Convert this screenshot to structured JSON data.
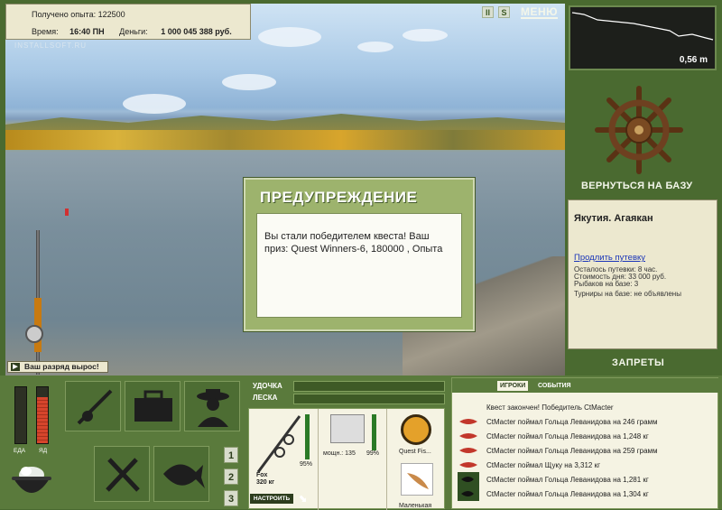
{
  "hud": {
    "exp_label": "Получено опыта:",
    "exp_value": "122500",
    "time_label": "Время:",
    "time_value": "16:40 ПН",
    "money_label": "Деньги:",
    "money_value": "1 000 045 388 руб."
  },
  "watermark": "INSTALLSOFT.RU",
  "controls": {
    "pause": "II",
    "sound": "S",
    "menu": "МЕНЮ"
  },
  "depth_readout": "0,56 m",
  "return_label": "ВЕРНУТЬСЯ НА БАЗУ",
  "location": {
    "title": "Якутия. Агаякан",
    "extend_link": "Продлить путевку",
    "lines": [
      "Осталось путевки: 8 час.",
      "Стоимость дня: 33 000 руб.",
      "Рыбаков на базе: 3",
      "Турниры на базе: не объявлены"
    ]
  },
  "bans_label": "ЗАПРЕТЫ",
  "dialog": {
    "title": "ПРЕДУПРЕЖДЕНИЕ",
    "message": "Вы стали победителем квеста! Ваш приз: Quest Winners-6, 180000 , Опыта"
  },
  "rank_message": "Ваш разряд вырос!",
  "gauges": {
    "food_label": "ЕДА",
    "poison_label": "ЯД",
    "food_level": 0,
    "poison_level": 0.82
  },
  "tackle": {
    "rod_label": "УДОЧКА",
    "line_label": "ЛЕСКА",
    "rod_durability": "95%",
    "rod_name": "Fox",
    "rod_weight": "320 кг",
    "reel_power": "мощн.: 135",
    "reel_durability": "99%",
    "line_name": "Quest Fis...",
    "bait_name": "Маленькая",
    "setup_button": "НАСТРОИТЬ"
  },
  "tabs_numbers": [
    "1",
    "2",
    "3"
  ],
  "chat": {
    "tab_players": "ИГРОКИ",
    "tab_events": "СОБЫТИЯ",
    "messages": [
      "Квест закончен! Победитель CtMacter",
      "CtMacter поймал Гольца Леванидова на 246 грамм",
      "CtMacter поймал Гольца Леванидова на 1,248 кг",
      "CtMacter поймал Гольца Леванидова на 259 грамм",
      "CtMacter поймал Щуку на 3,312 кг",
      "CtMacter поймал Гольца Леванидова на 1,281 кг",
      "CtMacter поймал Гольца Леванидова на 1,304 кг"
    ]
  },
  "colors": {
    "panel_green": "#4a6a30",
    "paper": "#ece8cf",
    "dialog_green": "#9db36d",
    "poison_red": "#d6452c"
  }
}
